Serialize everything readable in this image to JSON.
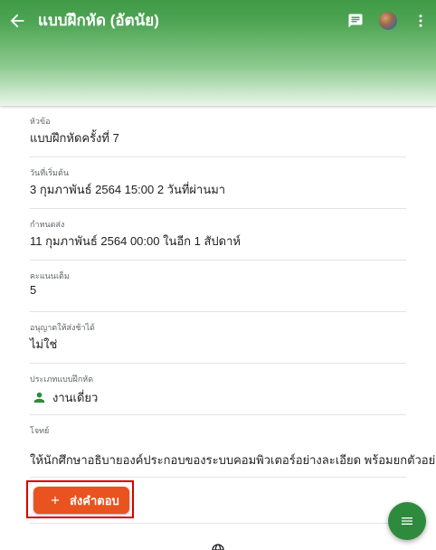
{
  "app_bar": {
    "title": "แบบฝึกหัด (อัตนัย)",
    "icons": [
      "arrow-back-icon",
      "comment-icon",
      "avatar",
      "more-vert-icon"
    ],
    "background_color": "#4fa655"
  },
  "fields": [
    {
      "label": "หัวข้อ",
      "value": "แบบฝึกหัดครั้งที่ 7"
    },
    {
      "label": "วันที่เริ่มต้น",
      "value": "3 กุมภาพันธ์ 2564 15:00 2 วันที่ผ่านมา"
    },
    {
      "label": "กำหนดส่ง",
      "value": "11 กุมภาพันธ์ 2564 00:00 ในอีก 1 สัปดาห์"
    },
    {
      "label": "คะแนนเต็ม",
      "value": "5"
    },
    {
      "label": "อนุญาตให้ส่งช้าได้",
      "value": "ไม่ใช่"
    },
    {
      "label": "ประเภทแบบฝึกหัด",
      "value": "งานเดี่ยว",
      "icon": "person-icon"
    },
    {
      "label": "โจทย์",
      "value": "ให้นักศึกษาอธิบายองค์ประกอบของระบบคอมพิวเตอร์อย่างละเอียด พร้อมยกตัวอย่าง"
    }
  ],
  "submit_button": {
    "label": "ส่งคำตอบ",
    "icon": "plus-icon",
    "color": "#e8531f",
    "highlight_color": "#d50000"
  },
  "fab": {
    "icon": "menu-icon",
    "color": "#2e8b3e"
  },
  "footer": {
    "icon": "globe-icon"
  }
}
